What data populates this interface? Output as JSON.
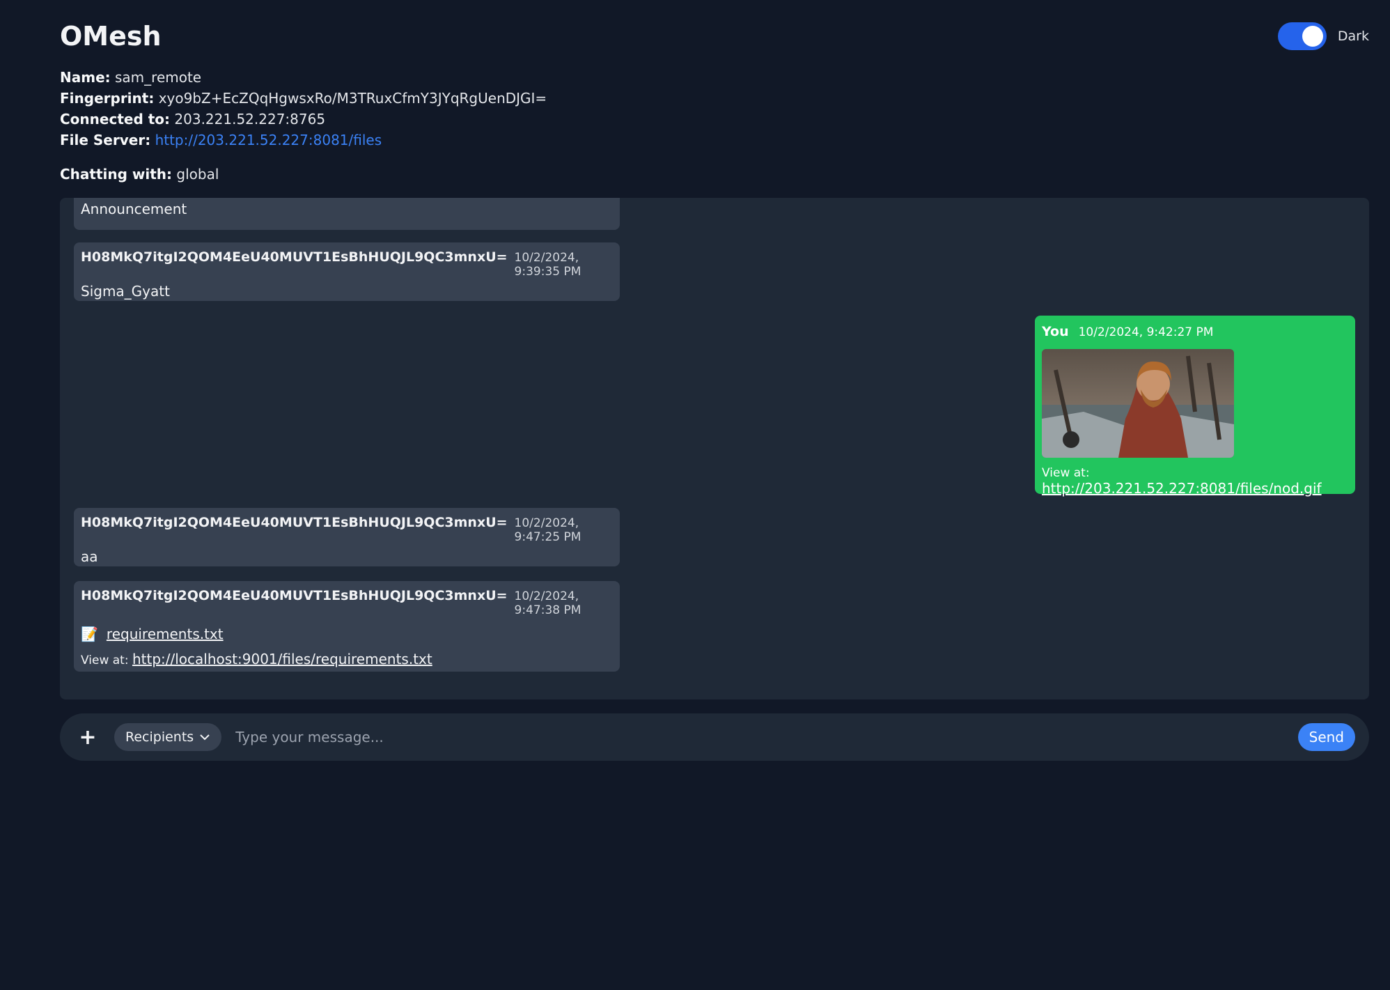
{
  "app": {
    "title": "OMesh"
  },
  "theme_toggle": {
    "label": "Dark",
    "on": true
  },
  "info": {
    "name_label": "Name:",
    "name": "sam_remote",
    "fingerprint_label": "Fingerprint:",
    "fingerprint": "xyo9bZ+EcZQqHgwsxRo/M3TRuxCfmY3JYqRgUenDJGI=",
    "connected_label": "Connected to:",
    "connected": "203.221.52.227:8765",
    "fileserver_label": "File Server:",
    "fileserver": "http://203.221.52.227:8081/files"
  },
  "chatting": {
    "label": "Chatting with:",
    "value": "global"
  },
  "messages": [
    {
      "body": "Announcement"
    },
    {
      "sender": "H08MkQ7itgI2QOM4EeU40MUVT1EsBhHUQJL9QC3mnxU=",
      "time": "10/2/2024, 9:39:35 PM",
      "body": "Sigma_Gyatt"
    },
    {
      "sender": "You",
      "time": "10/2/2024, 9:42:27 PM",
      "view_label": "View at:",
      "link": "http://203.221.52.227:8081/files/nod.gif"
    },
    {
      "sender": "H08MkQ7itgI2QOM4EeU40MUVT1EsBhHUQJL9QC3mnxU=",
      "time": "10/2/2024, 9:47:25 PM",
      "body": "aa"
    },
    {
      "sender": "H08MkQ7itgI2QOM4EeU40MUVT1EsBhHUQJL9QC3mnxU=",
      "time": "10/2/2024, 9:47:38 PM",
      "file_icon": "📝",
      "file": "requirements.txt",
      "view_label": "View at:",
      "link": "http://localhost:9001/files/requirements.txt"
    }
  ],
  "composer": {
    "attach_label": "+",
    "recipients_label": "Recipients",
    "placeholder": "Type your message...",
    "send_label": "Send"
  },
  "colors": {
    "background": "#111827",
    "panel": "#1f2937",
    "bubble": "#374151",
    "own_bubble": "#22c55e",
    "accent": "#3b82f6"
  }
}
